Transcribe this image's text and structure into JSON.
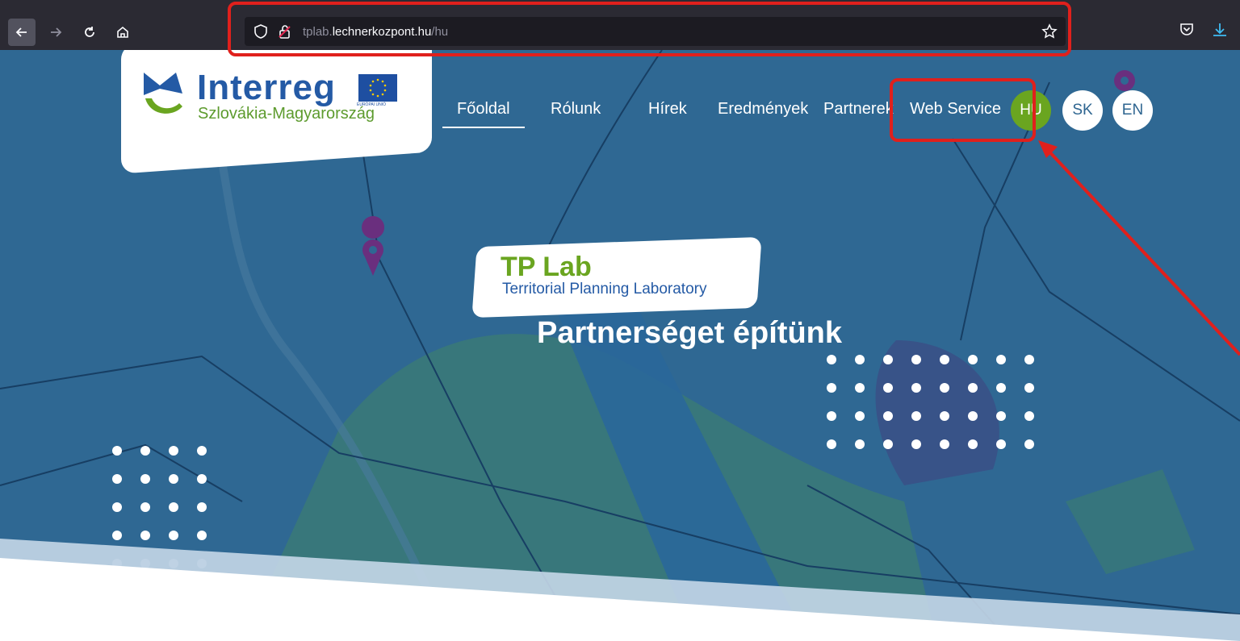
{
  "browser": {
    "url_host_prefix": "tplab.",
    "url_host_main": "lechnerkozpont.hu",
    "url_path": "/hu"
  },
  "icons": {
    "back": "arrow-left",
    "forward": "arrow-right",
    "reload": "reload",
    "home": "home",
    "shield": "tracking-protection-shield",
    "lock": "insecure-lock",
    "bookmark": "star-outline",
    "pocket": "pocket",
    "download": "download-arrow",
    "map_pin": "map-pin"
  },
  "site": {
    "logo_word": "Interreg",
    "logo_sub": "Szlovákia-Magyarország",
    "eu_caption": "EURÓPAI UNIÓ"
  },
  "nav": {
    "items": [
      "Főoldal",
      "Rólunk",
      "Hírek",
      "Eredmények",
      "Partnerek",
      "Web Service"
    ],
    "active_index": 0
  },
  "languages": [
    "HU",
    "SK",
    "EN"
  ],
  "hero": {
    "tp_title": "TP Lab",
    "tp_subtitle": "Territorial Planning Laboratory",
    "tagline": "Partnerséget építünk"
  },
  "colors": {
    "brand_green": "#6aa520",
    "brand_blue": "#245aa5",
    "hero_overlay": "#2e6590",
    "annotation_red": "#e0201c"
  }
}
